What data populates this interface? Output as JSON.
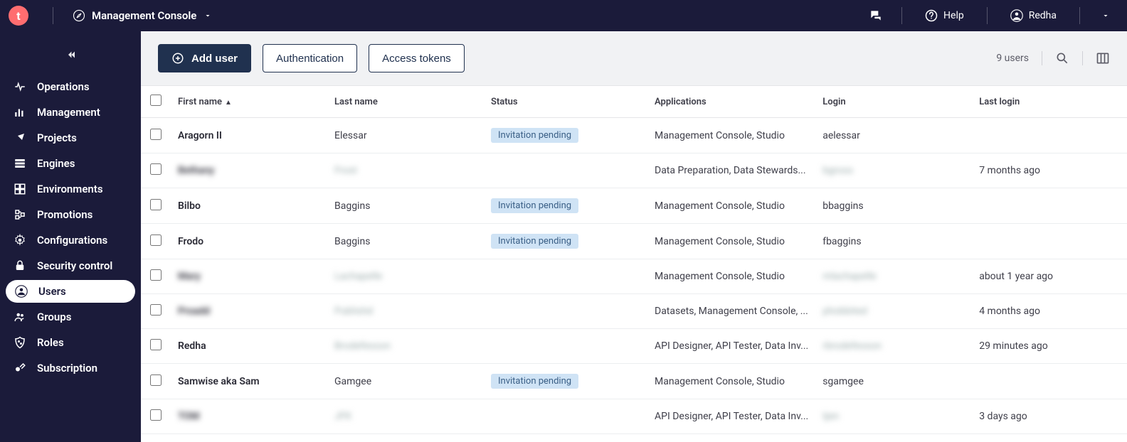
{
  "topbar": {
    "logo_letter": "t",
    "app_name": "Management Console",
    "help_label": "Help",
    "user_name": "Redha"
  },
  "sidebar": {
    "items": [
      {
        "key": "operations",
        "label": "Operations"
      },
      {
        "key": "management",
        "label": "Management"
      },
      {
        "key": "projects",
        "label": "Projects"
      },
      {
        "key": "engines",
        "label": "Engines"
      },
      {
        "key": "environments",
        "label": "Environments"
      },
      {
        "key": "promotions",
        "label": "Promotions"
      },
      {
        "key": "configurations",
        "label": "Configurations"
      },
      {
        "key": "security-control",
        "label": "Security control"
      },
      {
        "key": "users",
        "label": "Users",
        "active": true
      },
      {
        "key": "groups",
        "label": "Groups"
      },
      {
        "key": "roles",
        "label": "Roles"
      },
      {
        "key": "subscription",
        "label": "Subscription"
      }
    ]
  },
  "toolbar": {
    "add_user_label": "Add user",
    "authentication_label": "Authentication",
    "access_tokens_label": "Access tokens",
    "count_label": "9 users"
  },
  "table": {
    "columns": {
      "first_name": "First name",
      "last_name": "Last name",
      "status": "Status",
      "applications": "Applications",
      "login": "Login",
      "last_login": "Last login"
    },
    "status_pending_label": "Invitation pending",
    "rows": [
      {
        "first": "Aragorn II",
        "last": "Elessar",
        "status": "pending",
        "apps": "Management Console, Studio",
        "login": "aelessar",
        "last_login": ""
      },
      {
        "first": "Bethany",
        "last": "Frost",
        "status": "",
        "apps": "Data Preparation, Data Stewards...",
        "login": "bgross",
        "last_login": "7 months ago",
        "blur": true
      },
      {
        "first": "Bilbo",
        "last": "Baggins",
        "status": "pending",
        "apps": "Management Console, Studio",
        "login": "bbaggins",
        "last_login": ""
      },
      {
        "first": "Frodo",
        "last": "Baggins",
        "status": "pending",
        "apps": "Management Console, Studio",
        "login": "fbaggins",
        "last_login": ""
      },
      {
        "first": "Mary",
        "last": "Lachapelle",
        "status": "",
        "apps": "Management Console, Studio",
        "login": "mlachapelle",
        "last_login": "about 1 year ago",
        "blur": true
      },
      {
        "first": "Proadd",
        "last": "Publishd",
        "status": "",
        "apps": "Datasets, Management Console, ...",
        "login": "phobbited",
        "last_login": "4 months ago",
        "blur": true
      },
      {
        "first": "Redha",
        "last": "Brodefesson",
        "status": "",
        "apps": "API Designer, API Tester, Data Inv...",
        "login": "rbrodefesson",
        "last_login": "29 minutes ago",
        "blur_last": true,
        "blur_login": true
      },
      {
        "first": "Samwise aka Sam",
        "last": "Gamgee",
        "status": "pending",
        "apps": "Management Console, Studio",
        "login": "sgamgee",
        "last_login": ""
      },
      {
        "first": "TOM",
        "last": "JFK",
        "status": "",
        "apps": "API Designer, API Tester, Data Inv...",
        "login": "tjen",
        "last_login": "3 days ago",
        "blur": true
      }
    ]
  }
}
